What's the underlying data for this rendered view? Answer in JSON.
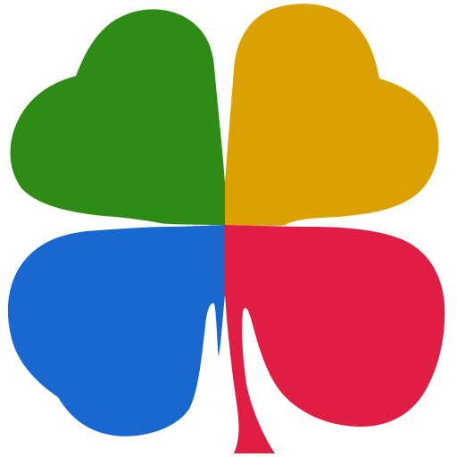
{
  "logo": {
    "icon": "four-leaf-clover-icon",
    "colors": {
      "top_left": "#2E8B16",
      "top_right": "#DAA100",
      "bottom_left": "#1868CF",
      "bottom_right": "#E01E44",
      "background": "#FFFFFF"
    }
  }
}
